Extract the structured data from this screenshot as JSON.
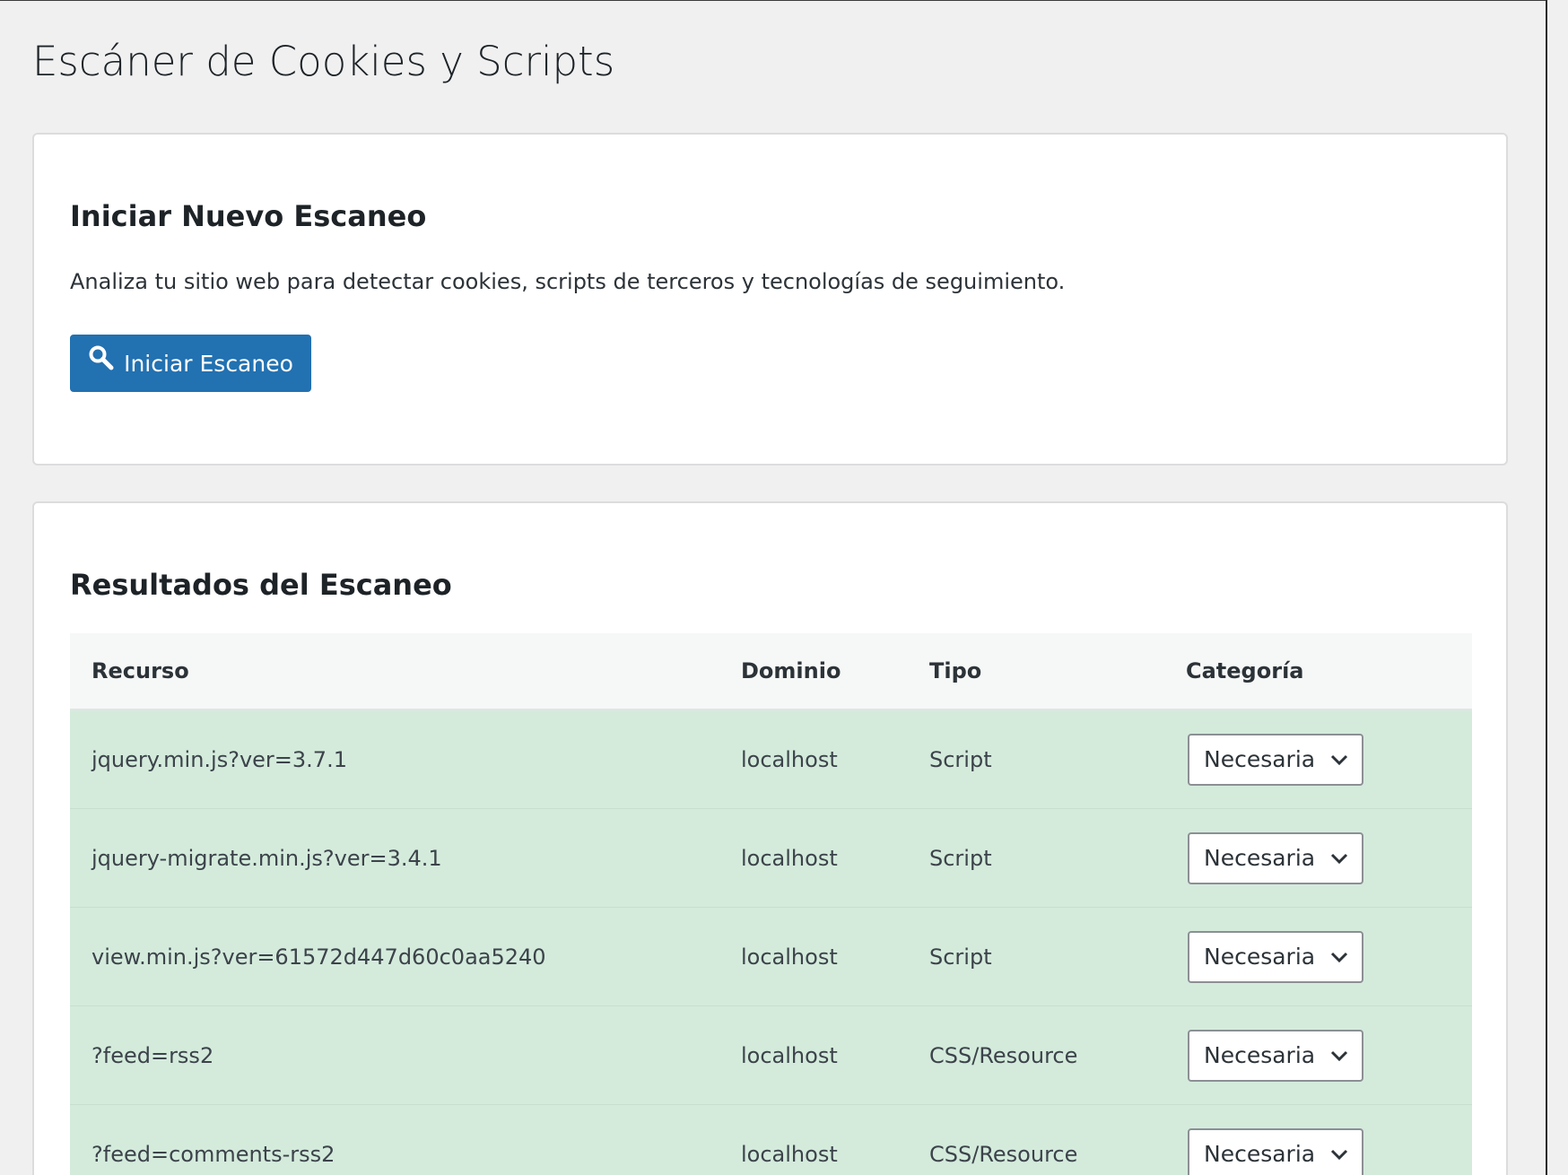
{
  "page": {
    "title": "Escáner de Cookies y Scripts"
  },
  "scan_card": {
    "heading": "Iniciar Nuevo Escaneo",
    "description": "Analiza tu sitio web para detectar cookies, scripts de terceros y tecnologías de seguimiento.",
    "button_label": "Iniciar Escaneo",
    "button_icon": "search-icon"
  },
  "results_card": {
    "heading": "Resultados del Escaneo",
    "columns": {
      "resource": "Recurso",
      "domain": "Dominio",
      "type": "Tipo",
      "category": "Categoría"
    },
    "rows": [
      {
        "resource": "jquery.min.js?ver=3.7.1",
        "domain": "localhost",
        "type": "Script",
        "category": "Necesaria"
      },
      {
        "resource": "jquery-migrate.min.js?ver=3.4.1",
        "domain": "localhost",
        "type": "Script",
        "category": "Necesaria"
      },
      {
        "resource": "view.min.js?ver=61572d447d60c0aa5240",
        "domain": "localhost",
        "type": "Script",
        "category": "Necesaria"
      },
      {
        "resource": "?feed=rss2",
        "domain": "localhost",
        "type": "CSS/Resource",
        "category": "Necesaria"
      },
      {
        "resource": "?feed=comments-rss2",
        "domain": "localhost",
        "type": "CSS/Resource",
        "category": "Necesaria"
      }
    ]
  },
  "colors": {
    "primary_button": "#2271b1",
    "row_highlight": "#d4ebdc",
    "page_background": "#f0f0f1"
  }
}
